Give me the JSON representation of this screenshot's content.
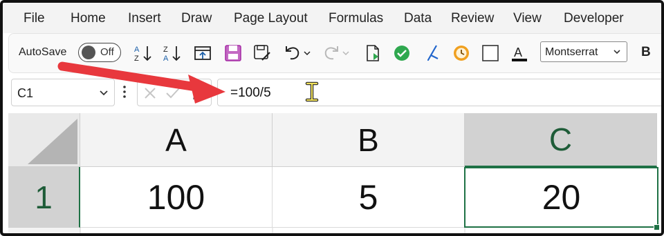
{
  "menu": {
    "items": [
      "File",
      "Home",
      "Insert",
      "Draw",
      "Page Layout",
      "Formulas",
      "Data",
      "Review",
      "View",
      "Developer"
    ]
  },
  "toolbar": {
    "autosave_label": "AutoSave",
    "autosave_state": "Off",
    "font_name": "Montserrat",
    "bold_label": "B",
    "icons": [
      "sort-ascending-icon",
      "sort-descending-icon",
      "freeze-panes-icon",
      "save-icon",
      "save-as-icon",
      "undo-icon",
      "redo-icon",
      "new-document-icon",
      "check-circle-icon",
      "pen-icon",
      "clock-icon",
      "border-icon",
      "font-color-icon"
    ]
  },
  "formula_bar": {
    "name_box": "C1",
    "formula": "=100/5"
  },
  "sheet": {
    "columns": [
      "A",
      "B",
      "C"
    ],
    "rows": [
      {
        "header": "1",
        "cells": [
          "100",
          "5",
          "20"
        ]
      }
    ],
    "selected_cell": "C1"
  },
  "colors": {
    "accent_green": "#1e7145",
    "arrow_red": "#e8383d",
    "save_purple": "#a52aa5",
    "check_green": "#2fa84f",
    "clock_orange": "#f0a020",
    "pen_blue": "#2266cc"
  }
}
